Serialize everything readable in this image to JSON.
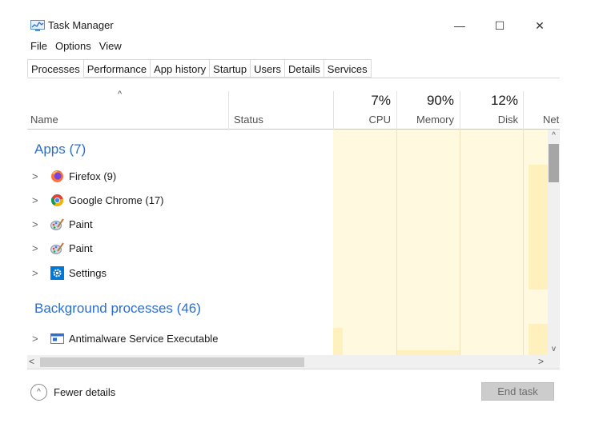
{
  "window": {
    "title": "Task Manager",
    "minimize_glyph": "—",
    "maximize_glyph": "☐",
    "close_glyph": "✕"
  },
  "menu": [
    "File",
    "Options",
    "View"
  ],
  "tabs": [
    {
      "label": "Processes",
      "active": true
    },
    {
      "label": "Performance"
    },
    {
      "label": "App history"
    },
    {
      "label": "Startup"
    },
    {
      "label": "Users"
    },
    {
      "label": "Details"
    },
    {
      "label": "Services"
    }
  ],
  "columns": {
    "sort_glyph": "^",
    "name": "Name",
    "status": "Status",
    "cpu": {
      "pct": "7%",
      "label": "CPU"
    },
    "memory": {
      "pct": "90%",
      "label": "Memory"
    },
    "disk": {
      "pct": "12%",
      "label": "Disk"
    },
    "network": {
      "label": "Net"
    }
  },
  "groups": {
    "apps": "Apps (7)",
    "background": "Background processes (46)"
  },
  "rows": [
    {
      "label": "Firefox (9)",
      "icon": "firefox-icon"
    },
    {
      "label": "Google Chrome (17)",
      "icon": "chrome-icon"
    },
    {
      "label": "Paint",
      "icon": "paint-icon"
    },
    {
      "label": "Paint",
      "icon": "paint-icon"
    },
    {
      "label": "Settings",
      "icon": "settings-icon"
    },
    {
      "label": "Antimalware Service Executable",
      "icon": "service-icon"
    }
  ],
  "chevron": ">",
  "scroll": {
    "up": "^",
    "down": "v",
    "left": "<",
    "right": ">"
  },
  "footer": {
    "fewer_details": "Fewer details",
    "fewer_glyph": "^",
    "end_task": "End task"
  },
  "colors": {
    "accent": "#2b6ecf",
    "heat_light": "#fff9e0",
    "heat_dark": "#fff1bd"
  }
}
